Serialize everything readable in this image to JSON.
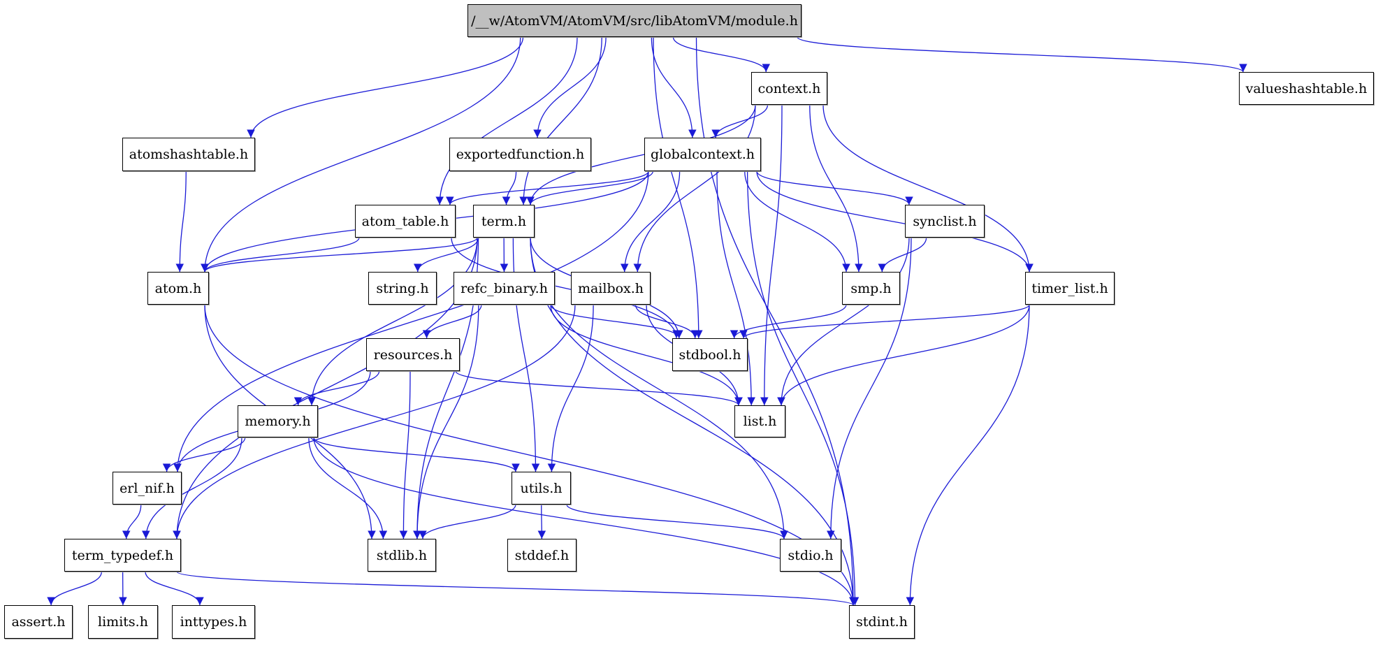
{
  "graph": {
    "title": "/__w/AtomVM/AtomVM/src/libAtomVM/module.h",
    "edge_color": "#1a1ad6",
    "root_fill": "#bfbfbf",
    "nodes": {
      "module": "/__w/AtomVM/AtomVM/src/libAtomVM/module.h",
      "context": "context.h",
      "valueshashtable": "valueshashtable.h",
      "atomshashtable": "atomshashtable.h",
      "exportedfunction": "exportedfunction.h",
      "globalcontext": "globalcontext.h",
      "atom_table": "atom_table.h",
      "term": "term.h",
      "synclist": "synclist.h",
      "atom": "atom.h",
      "string": "string.h",
      "refc_binary": "refc_binary.h",
      "mailbox": "mailbox.h",
      "smp": "smp.h",
      "timer_list": "timer_list.h",
      "resources": "resources.h",
      "stdbool": "stdbool.h",
      "memory": "memory.h",
      "list": "list.h",
      "erl_nif": "erl_nif.h",
      "utils": "utils.h",
      "term_typedef": "term_typedef.h",
      "stdlib": "stdlib.h",
      "stddef": "stddef.h",
      "stdio": "stdio.h",
      "assert": "assert.h",
      "limits": "limits.h",
      "inttypes": "inttypes.h",
      "stdint": "stdint.h"
    },
    "edges": [
      [
        "module",
        "atomshashtable"
      ],
      [
        "module",
        "atom"
      ],
      [
        "module",
        "atom_table"
      ],
      [
        "module",
        "term"
      ],
      [
        "module",
        "exportedfunction"
      ],
      [
        "module",
        "globalcontext"
      ],
      [
        "module",
        "context"
      ],
      [
        "module",
        "stdbool"
      ],
      [
        "module",
        "stdint"
      ],
      [
        "module",
        "valueshashtable"
      ],
      [
        "context",
        "globalcontext"
      ],
      [
        "context",
        "term"
      ],
      [
        "context",
        "mailbox"
      ],
      [
        "context",
        "smp"
      ],
      [
        "context",
        "timer_list"
      ],
      [
        "context",
        "list"
      ],
      [
        "atomshashtable",
        "atom"
      ],
      [
        "exportedfunction",
        "term"
      ],
      [
        "globalcontext",
        "atom_table"
      ],
      [
        "globalcontext",
        "term"
      ],
      [
        "globalcontext",
        "atom"
      ],
      [
        "globalcontext",
        "erl_nif"
      ],
      [
        "globalcontext",
        "mailbox"
      ],
      [
        "globalcontext",
        "list"
      ],
      [
        "globalcontext",
        "smp"
      ],
      [
        "globalcontext",
        "synclist"
      ],
      [
        "globalcontext",
        "timer_list"
      ],
      [
        "globalcontext",
        "stdint"
      ],
      [
        "atom_table",
        "atom"
      ],
      [
        "atom_table",
        "stdbool"
      ],
      [
        "term",
        "string"
      ],
      [
        "term",
        "refc_binary"
      ],
      [
        "term",
        "memory"
      ],
      [
        "term",
        "utils"
      ],
      [
        "term",
        "term_typedef"
      ],
      [
        "term",
        "stdlib"
      ],
      [
        "term",
        "stdbool"
      ],
      [
        "term",
        "stdio"
      ],
      [
        "term",
        "stdint"
      ],
      [
        "term",
        "atom"
      ],
      [
        "synclist",
        "smp"
      ],
      [
        "synclist",
        "list"
      ],
      [
        "synclist",
        "stdio"
      ],
      [
        "atom",
        "stdlib"
      ],
      [
        "atom",
        "stdint"
      ],
      [
        "refc_binary",
        "resources"
      ],
      [
        "refc_binary",
        "stdbool"
      ],
      [
        "refc_binary",
        "list"
      ],
      [
        "refc_binary",
        "stdlib"
      ],
      [
        "mailbox",
        "stdbool"
      ],
      [
        "mailbox",
        "list"
      ],
      [
        "mailbox",
        "utils"
      ],
      [
        "mailbox",
        "term_typedef"
      ],
      [
        "smp",
        "stdbool"
      ],
      [
        "timer_list",
        "stdbool"
      ],
      [
        "timer_list",
        "list"
      ],
      [
        "timer_list",
        "stdint"
      ],
      [
        "resources",
        "memory"
      ],
      [
        "resources",
        "erl_nif"
      ],
      [
        "resources",
        "list"
      ],
      [
        "resources",
        "stdlib"
      ],
      [
        "memory",
        "erl_nif"
      ],
      [
        "memory",
        "term_typedef"
      ],
      [
        "memory",
        "utils"
      ],
      [
        "memory",
        "stdlib"
      ],
      [
        "memory",
        "stdint"
      ],
      [
        "erl_nif",
        "term_typedef"
      ],
      [
        "utils",
        "stdlib"
      ],
      [
        "utils",
        "stddef"
      ],
      [
        "utils",
        "stdio"
      ],
      [
        "term_typedef",
        "assert"
      ],
      [
        "term_typedef",
        "limits"
      ],
      [
        "term_typedef",
        "inttypes"
      ],
      [
        "term_typedef",
        "stdint"
      ]
    ]
  }
}
